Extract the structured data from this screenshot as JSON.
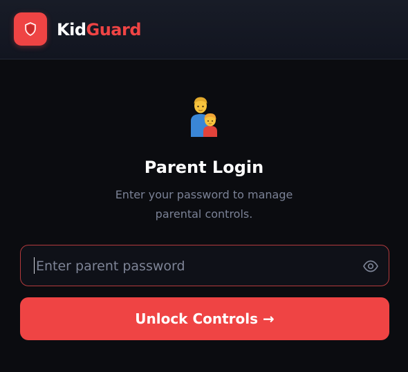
{
  "header": {
    "logo_icon": "shield-icon",
    "brand_part1": "Kid",
    "brand_part2": "Guard",
    "accent_color": "#ef4444"
  },
  "login": {
    "illustration_icon": "parent-child-emoji-icon",
    "title": "Parent Login",
    "subtitle": "Enter your password to manage parental controls.",
    "password_placeholder": "Enter parent password",
    "password_value": "",
    "toggle_visibility_icon": "eye-icon",
    "submit_label": "Unlock Controls →"
  }
}
